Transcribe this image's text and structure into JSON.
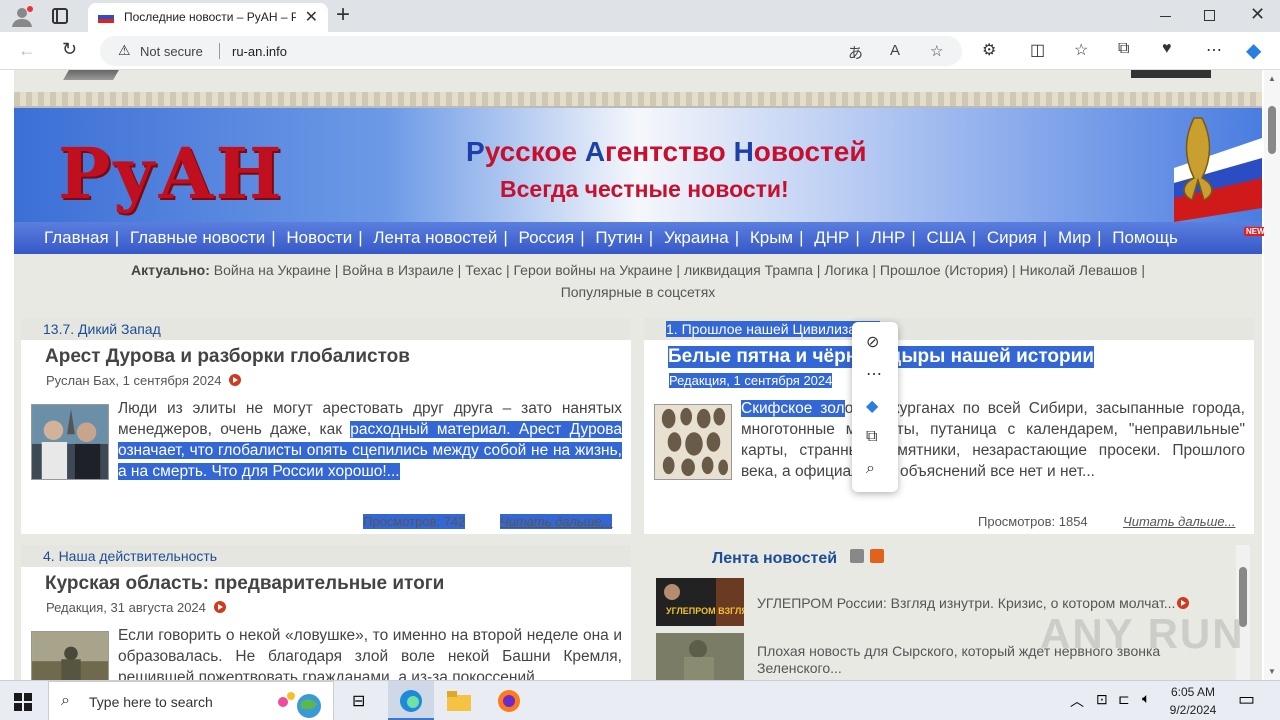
{
  "browser": {
    "tab_title": "Последние новости – РуАН – Русское Агентство Новостей",
    "security_label": "Not secure",
    "url": "ru-an.info"
  },
  "banner": {
    "logo": "РуАН",
    "title_parts": [
      "Р",
      "усское ",
      "А",
      "гентство ",
      "Н",
      "овостей"
    ],
    "subtitle": "Всегда честные новости!"
  },
  "mainnav": {
    "items": [
      "Главная",
      "Главные новости",
      "Новости",
      "Лента новостей",
      "Россия",
      "Путин",
      "Украина",
      "Крым",
      "ДНР",
      "ЛНР",
      "США",
      "Сирия",
      "Мир",
      "Помощь"
    ],
    "new_badge": "NEW"
  },
  "actual": {
    "label": "Актуально:",
    "links": [
      "Война на Украине",
      "Война в Израиле",
      "Техас",
      "Герои войны на Украине",
      "ликвидация Трампа",
      "Логика",
      "Прошлое (История)",
      "Николай Левашов"
    ],
    "popular": "Популярные в соцсетях"
  },
  "articles": [
    {
      "category": "13.7. Дикий Запад",
      "title": "Арест Дурова и разборки глобалистов",
      "meta": "Руслан Бах, 1 сентября 2024",
      "text_plain": "Люди из элиты не могут арестовать друг друга – зато нанятых менеджеров, очень даже, как ",
      "text_selected": "расходный материал. Арест Дурова означает, что глобалисты опять сцепились между собой не на жизнь, а на смерть. Что для России хорошо!...",
      "views": "Просмотров: 742",
      "readmore": "Читать дальше..."
    },
    {
      "category": "1. Прошлое нашей Цивилизации",
      "title": "Белые пятна и чёрные дыры нашей истории",
      "meta": "Редакция, 1 сентября 2024",
      "text_selected": "Скифское зол",
      "text_plain": "ото в курганах по всей Сибири, засыпанные города, многотонные мегалиты, путаница с календарем, \"неправильные\" карты, странные памятники, незарастающие просеки. Прошлого века, а официальных объяснений все нет и нет...",
      "views": "Просмотров: 1854",
      "readmore": "Читать дальше..."
    },
    {
      "category": "4. Наша действительность",
      "title": "Курская область: предварительные итоги",
      "meta": "Редакция, 31 августа 2024",
      "text_plain": "Если говорить о некой «ловушке», то именно на второй неделе она и образовалась. Не благодаря злой воле некой Башни Кремля, решившей пожертвовать гражданами, а из-за покоссений"
    }
  ],
  "news_feed": {
    "heading": "Лента новостей",
    "items": [
      {
        "image_caption": "УГЛЕПРОМ ВЗГЛЯД ИЗНУТРИ",
        "text": "УГЛЕПРОМ России: Взгляд изнутри. Кризис, о котором молчат..."
      },
      {
        "text": "Плохая новость для Сырского, который ждет нервного звонка Зеленского..."
      }
    ]
  },
  "taskbar": {
    "search_placeholder": "Type here to search",
    "time": "6:05 AM",
    "date": "9/2/2024"
  },
  "watermark": "ANY RUN"
}
